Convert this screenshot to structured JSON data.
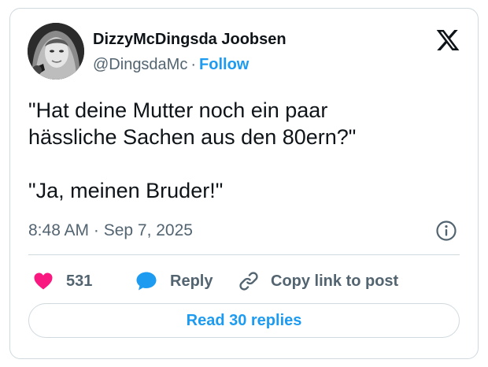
{
  "author": {
    "name": "DizzyMcDingsda Joobsen",
    "handle": "@DingsdaMc",
    "separator": "·",
    "follow_label": "Follow"
  },
  "tweet": {
    "lines_block1": [
      "\"Hat deine Mutter noch ein paar",
      "hässliche Sachen aus den 80ern?\""
    ],
    "line_block2": "\"Ja, meinen Bruder!\"",
    "timestamp": "8:48 AM · Sep 7, 2025"
  },
  "actions": {
    "like_count": "531",
    "reply_label": "Reply",
    "copy_label": "Copy link to post"
  },
  "read_replies_label": "Read 30 replies",
  "icons": {
    "logo": "x-logo-icon",
    "info": "info-icon",
    "like": "heart-icon",
    "reply": "speech-bubble-icon",
    "copy": "link-icon"
  },
  "colors": {
    "accent": "#1d9bf0",
    "like": "#f91880",
    "text": "#0f1419",
    "muted": "#536471",
    "border": "#cfd9de"
  }
}
